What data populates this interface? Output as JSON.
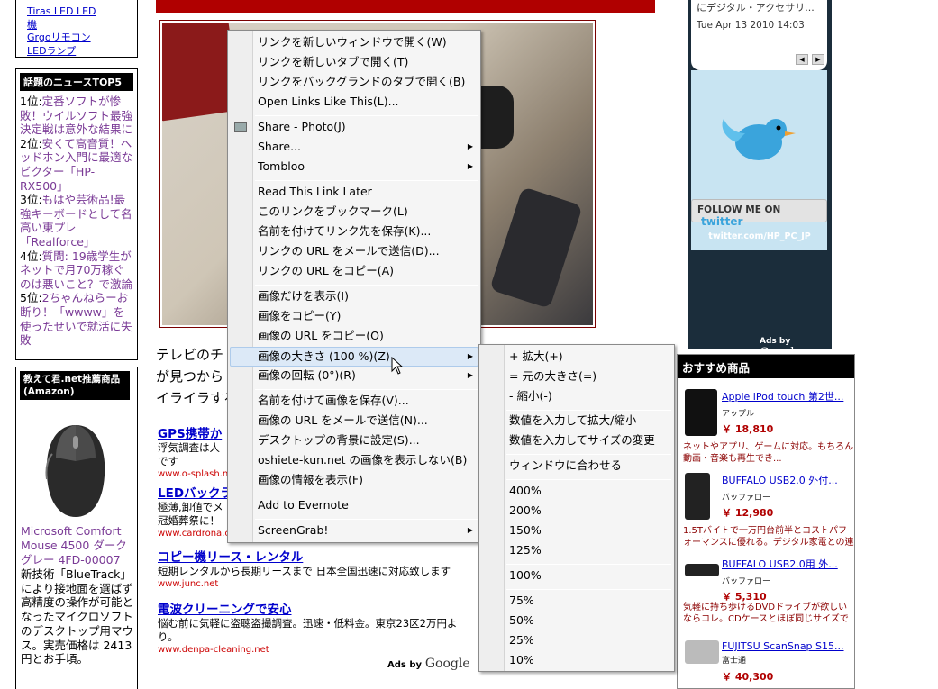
{
  "left": {
    "top_links": [
      "Tiras LED LED",
      "機",
      "Grgoリモコン",
      "LEDランプ"
    ],
    "news_header": "話題のニュースTOP5",
    "news": [
      {
        "rank": "1位:",
        "text": "定番ソフトが惨敗！ウイルソフト最強決定戦は意外な結果に"
      },
      {
        "rank": "2位:",
        "text": "安くて高音質！ヘッドホン入門に最適なビクター「HP-RX500」"
      },
      {
        "rank": "3位:",
        "text": "もはや芸術品!最強キーボードとして名高い東プレ「Realforce」"
      },
      {
        "rank": "4位:",
        "text": "質問: 19歳学生がネットで月70万稼ぐのは悪いこと？で激論"
      },
      {
        "rank": "5位:",
        "text": "2ちゃんねらーお断り！「wwww」を使ったせいで就活に失敗"
      }
    ],
    "amazon_header": "教えて君.net推薦商品(Amazon)",
    "amazon_product": "Microsoft Comfort Mouse 4500 ダークグレー 4FD-00007",
    "amazon_desc": "新技術「BlueTrack」により接地面を選ばず高精度の操作が可能となったマイクロソフトのデスクトップ用マウス。実売価格は 2413 円とお手頃。"
  },
  "article": {
    "text_lines": [
      "テレビのチ",
      "が見つから",
      "イライラする"
    ],
    "ads": [
      {
        "title": "GPS携帯か",
        "desc": "浮気調査は人\nです",
        "url": "www.o-splash.ne"
      },
      {
        "title": "LEDバックラ",
        "desc": "極薄,卸値でメ\n冠婚葬祭に！",
        "url": "www.cardrona.c"
      },
      {
        "title": "コピー機リース・レンタル",
        "desc": "短期レンタルから長期リースまで 日本全国迅速に対応致します",
        "url": "www.junc.net"
      },
      {
        "title": "電波クリーニングで安心",
        "desc": "悩む前に気軽に盗聴盗撮調査。迅速・低料金。東京23区2万円よ\nり。",
        "url": "www.denpa-cleaning.net"
      }
    ],
    "ads_by": "Ads by",
    "google": "Google"
  },
  "twitter": {
    "tweet": "にデジタル・アクセサリ...",
    "time": "Tue Apr 13 2010 14:03",
    "follow": "FOLLOW ME ON",
    "brand": "twitter",
    "handle": "twitter.com/HP_PC_JP",
    "ads_by": "Ads by",
    "google": "Google"
  },
  "reco": {
    "header": "おすすめ商品",
    "products": [
      {
        "name": "Apple iPod touch 第2世...",
        "maker": "アップル",
        "price": "￥ 18,810",
        "desc": "ネットやアプリ、ゲームに対応。もちろん動画・音楽も再生でき..."
      },
      {
        "name": "BUFFALO USB2.0 外付...",
        "maker": "バッファロー",
        "price": "￥ 12,980",
        "desc": "1.5Tバイトで一万円台前半とコストパフォーマンスに優れる。デジタル家電との連携機能も..."
      },
      {
        "name": "BUFFALO USB2.0用 外...",
        "maker": "バッファロー",
        "price": "￥ 5,310",
        "desc": "気軽に持ち歩けるDVDドライブが欲しいならコレ。CDケースとほぼ同じサイズで重さも320g..."
      },
      {
        "name": "FUJITSU ScanSnap S15...",
        "maker": "富士通",
        "price": "￥ 40,300",
        "desc": ""
      }
    ]
  },
  "context_menu": [
    {
      "label": "リンクを新しいウィンドウで開く(W)"
    },
    {
      "label": "リンクを新しいタブで開く(T)"
    },
    {
      "label": "リンクをバックグランドのタブで開く(B)"
    },
    {
      "label": "Open Links Like This(L)..."
    },
    {
      "label": "Share - Photo(J)"
    },
    {
      "label": "Share..."
    },
    {
      "label": "Tombloo"
    },
    {
      "label": "Read This Link Later"
    },
    {
      "label": "このリンクをブックマーク(L)"
    },
    {
      "label": "名前を付けてリンク先を保存(K)..."
    },
    {
      "label": "リンクの URL をメールで送信(D)..."
    },
    {
      "label": "リンクの URL をコピー(A)"
    },
    {
      "label": "画像だけを表示(I)"
    },
    {
      "label": "画像をコピー(Y)"
    },
    {
      "label": "画像の URL をコピー(O)"
    },
    {
      "label": "画像の大きさ (100 %)(Z)"
    },
    {
      "label": "画像の回転 (0°)(R)"
    },
    {
      "label": "名前を付けて画像を保存(V)..."
    },
    {
      "label": "画像の URL をメールで送信(N)..."
    },
    {
      "label": "デスクトップの背景に設定(S)..."
    },
    {
      "label": "oshiete-kun.net の画像を表示しない(B)"
    },
    {
      "label": "画像の情報を表示(F)"
    },
    {
      "label": "Add to Evernote"
    },
    {
      "label": "ScreenGrab!"
    }
  ],
  "submenu": [
    {
      "label": "+ 拡大(+)"
    },
    {
      "label": "= 元の大きさ(=)"
    },
    {
      "label": "- 縮小(-)"
    },
    {
      "label": "数値を入力して拡大/縮小"
    },
    {
      "label": "数値を入力してサイズの変更"
    },
    {
      "label": "ウィンドウに合わせる"
    },
    {
      "label": "400%"
    },
    {
      "label": "200%"
    },
    {
      "label": "150%"
    },
    {
      "label": "125%"
    },
    {
      "label": "100%"
    },
    {
      "label": "75%"
    },
    {
      "label": "50%"
    },
    {
      "label": "25%"
    },
    {
      "label": "10%"
    }
  ],
  "glyphs": {
    "arrow": "▶",
    "cursor": "↖"
  }
}
